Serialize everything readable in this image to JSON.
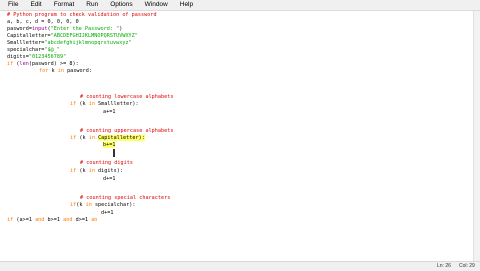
{
  "menu": [
    "File",
    "Edit",
    "Format",
    "Run",
    "Options",
    "Window",
    "Help"
  ],
  "code": {
    "l1": "# Python program to check validation of password",
    "l2": "a, b, c, d = 0, 0, 0, 0",
    "l3_a": "pasword=",
    "l3_b": "input",
    "l3_c": "(",
    "l3_d": "\"Enter the Password: \"",
    "l3_e": ")",
    "l4_a": "Capitalletter=",
    "l4_b": "\"ABCDEFGHIJKLMNOPQRSTUVWXYZ\"",
    "l5_a": "Smallletter=",
    "l5_b": "\"abcdefghijklmnopqrstuvwxyz\"",
    "l6_a": "specialchar=",
    "l6_b": "\"$@_\"",
    "l7_a": "digits=",
    "l7_b": "\"0123456789\"",
    "l8_a": "if",
    "l8_b": " (",
    "l8_c": "len",
    "l8_d": "(pasword) >= 8):",
    "l9_a": "for",
    "l9_b": " k ",
    "l9_c": "in",
    "l9_d": " pasword:",
    "l10": "# counting lowercase alphabets",
    "l11_a": "if",
    "l11_b": " (k ",
    "l11_c": "in",
    "l11_d": " Smallletter):",
    "l12": "a+=1",
    "l13": "# counting uppercase alphabets",
    "l14_a": "if",
    "l14_b": " (k ",
    "l14_c": "in",
    "l14_d": " ",
    "l14_e": "Capitalletter):",
    "l15": "b+=1",
    "l16": "# counting digits",
    "l17_a": "if",
    "l17_b": " (k ",
    "l17_c": "in",
    "l17_d": " digits):",
    "l18": "d+=1",
    "l19": "# counting special characters",
    "l20_a": "if",
    "l20_b": "(k ",
    "l20_c": "in",
    "l20_d": " specialchar):",
    "l21": "d+=1",
    "l22_a": "if",
    "l22_b": " (a>=1 ",
    "l22_c": "and",
    "l22_d": " b>=1 ",
    "l22_e": "and",
    "l22_f": " d>=1 ",
    "l22_g": "an"
  },
  "status": {
    "line": "Ln: 26",
    "col": "Col: 29"
  }
}
